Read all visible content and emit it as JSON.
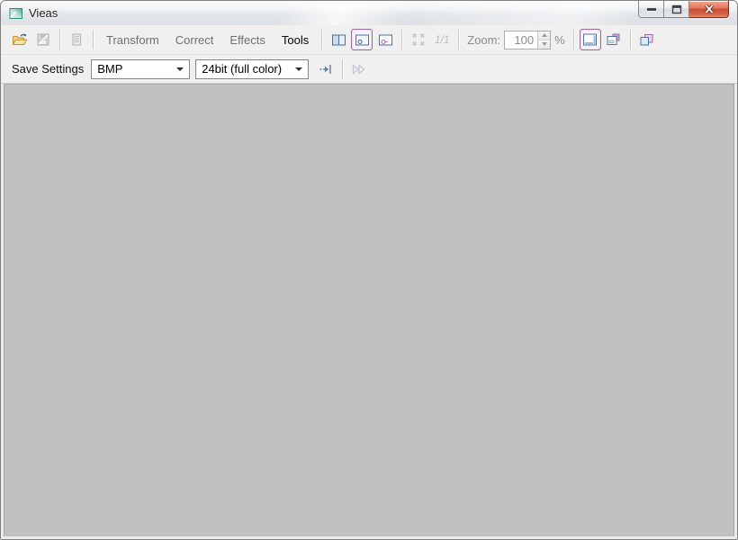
{
  "window": {
    "title": "Vieas"
  },
  "toolbar_main": {
    "menu": [
      {
        "label": "Transform",
        "enabled": false
      },
      {
        "label": "Correct",
        "enabled": false
      },
      {
        "label": "Effects",
        "enabled": false
      },
      {
        "label": "Tools",
        "enabled": true
      }
    ],
    "actual_size_label": "1/1",
    "zoom_label": "Zoom:",
    "zoom_value": "100",
    "zoom_unit": "%",
    "zoom_enabled": false
  },
  "toolbar_save": {
    "label": "Save Settings",
    "format_selected": "BMP",
    "depth_selected": "24bit (full color)"
  },
  "icons": {
    "app": "vieas-app-icon",
    "open": "open-folder-icon",
    "save": "save-floppy-icon",
    "properties": "image-properties-icon",
    "dual_pane": "dual-pane-icon",
    "view_original": "view-window-o-icon",
    "view_preview": "view-window-p-icon",
    "fit_window": "fit-to-window-arrows-icon",
    "actual_size": "actual-size-1-1-icon",
    "scrollbars": "window-scrollbars-icon",
    "overlay_panel": "overlay-panel-icon",
    "cascade": "cascade-windows-icon",
    "apply": "apply-arrow-to-bar-icon",
    "fast_forward": "double-chevron-icon",
    "minimize": "minimize-icon",
    "maximize": "maximize-icon",
    "close": "close-x-icon"
  },
  "colors": {
    "canvas": "#c1c1c1",
    "toolbar_bg": "#f0f0f0",
    "selected_toggle_border": "#9a6d9a",
    "close_button_red": "#cf4938",
    "folder_yellow": "#f3d488",
    "icon_blue_outline": "#4e6f96",
    "icon_pink_fill": "#cfa3de"
  }
}
